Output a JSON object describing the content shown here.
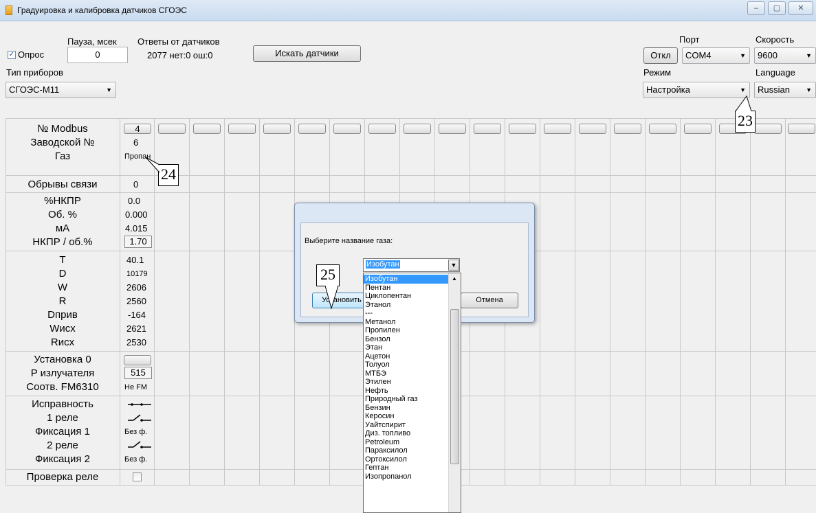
{
  "window": {
    "title": "Градуировка и калибровка датчиков СГОЭС",
    "minimize": "–",
    "maximize": "▢",
    "close": "✕"
  },
  "toolbar": {
    "pause_label": "Пауза, мсек",
    "responses_label": "Ответы от датчиков",
    "poll_label": "Опрос",
    "pause_value": "0",
    "responses_value": "2077 нет:0 ош:0",
    "search_button": "Искать датчики",
    "device_type_label": "Тип приборов",
    "device_type_value": "СГОЭС-М11",
    "port_label": "Порт",
    "speed_label": "Скорость",
    "disconnect_button": "Откл",
    "port_value": "COM4",
    "speed_value": "9600",
    "mode_label": "Режим",
    "mode_value": "Настройка",
    "language_label": "Language",
    "language_value": "Russian"
  },
  "rows": {
    "modbus": "№ Modbus",
    "serial": "Заводской №",
    "gas": "Газ",
    "link_breaks": "Обрывы связи",
    "lel": "%НКПР",
    "vol": "Об. %",
    "ma": "мА",
    "lel_vol": "НКПР / об.%",
    "t": "T",
    "d": "D",
    "w": "W",
    "r": "R",
    "dpriv": "Dприв",
    "wisx": "Wисх",
    "risx": "Rисх",
    "zero": "Установка 0",
    "emitter": "P излучателя",
    "fm": "Соотв. FM6310",
    "health": "Исправность",
    "relay1": "1 реле",
    "fix1": "Фиксация 1",
    "relay2": "2 реле",
    "fix2": "Фиксация 2",
    "relay_check": "Проверка реле"
  },
  "sensor1": {
    "modbus": "4",
    "serial": "6",
    "gas": "Пропан",
    "link_breaks": "0",
    "lel": "0.0",
    "vol": "0.000",
    "ma": "4.015",
    "lel_vol": "1.70",
    "t": "40.1",
    "d": "10179",
    "w": "2606",
    "r": "2560",
    "dpriv": "-164",
    "wisx": "2621",
    "risx": "2530",
    "emitter": "515",
    "fm": "Не FM",
    "fix1": "Без ф.",
    "fix2": "Без ф."
  },
  "dialog": {
    "prompt": "Выберите название газа:",
    "selected": "Изобутан",
    "ok_button": "Установить",
    "cancel_button": "Отмена"
  },
  "gas_list": [
    "Изобутан",
    "Пентан",
    "Циклопентан",
    "Этанол",
    "---",
    "Метанол",
    "Пропилен",
    "Бензол",
    "Этан",
    "Ацетон",
    "Толуол",
    "МТБЭ",
    "Этилен",
    "Нефть",
    "Природный газ",
    "Бензин",
    "Керосин",
    "Уайтспирит",
    "Диз. топливо",
    "Petroleum",
    "Параксилол",
    "Ортоксилол",
    "Гептан",
    "Изопропанол"
  ],
  "callouts": {
    "c23": "23",
    "c24": "24",
    "c25": "25"
  },
  "colors": {
    "selection": "#3399ff",
    "titlebar": "#c9dcf0"
  }
}
